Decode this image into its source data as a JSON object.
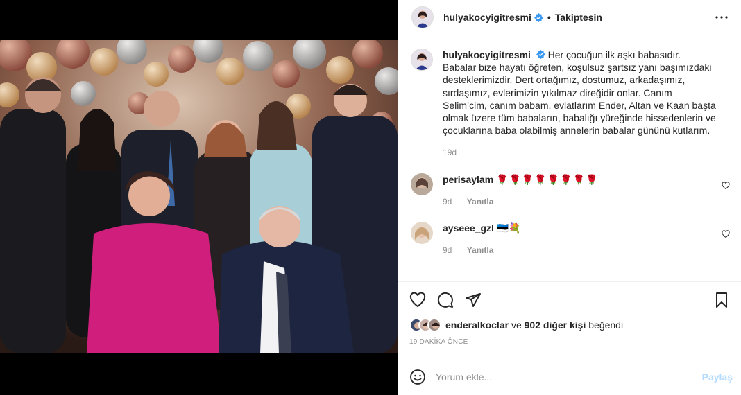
{
  "header": {
    "username": "hulyakocyigitresmi",
    "separator": "•",
    "follow_status": "Takiptesin",
    "more_icon": "more-horizontal-icon"
  },
  "caption": {
    "username": "hulyakocyigitresmi",
    "text": "Her çocuğun ilk aşkı babasıdır. Babalar bize hayatı öğreten, koşulsuz şartsız yanı başımızdaki desteklerimizdir. Dert ortağımız, dostumuz, arkadaşımız, sırdaşımız, evlerimizin yıkılmaz direğidir onlar. Canım Selim’cim, canım babam, evlatlarım Ender, Altan ve Kaan başta olmak üzere tüm babaların, babalığı yüreğinde hissedenlerin ve çocuklarına baba olabilmiş annelerin babalar gününü kutlarım.",
    "age": "19d"
  },
  "comments": [
    {
      "username": "perisaylam",
      "text": "🌹🌹🌹🌹🌹🌹🌹🌹",
      "age": "9d",
      "reply_label": "Yanıtla"
    },
    {
      "username": "ayseee_gzl",
      "text": "🇪🇪💐",
      "age": "9d",
      "reply_label": "Yanıtla"
    }
  ],
  "likes": {
    "first_user": "enderalkoclar",
    "connector": "ve",
    "others": "902 diğer kişi",
    "suffix": "beğendi"
  },
  "timestamp": "19 DAKİKA ÖNCE",
  "composer": {
    "placeholder": "Yorum ekle...",
    "post_label": "Paylaş"
  },
  "colors": {
    "verified": "#3897f0",
    "post_button_disabled": "#b3dbff",
    "muted_text": "#8e8e8e"
  }
}
